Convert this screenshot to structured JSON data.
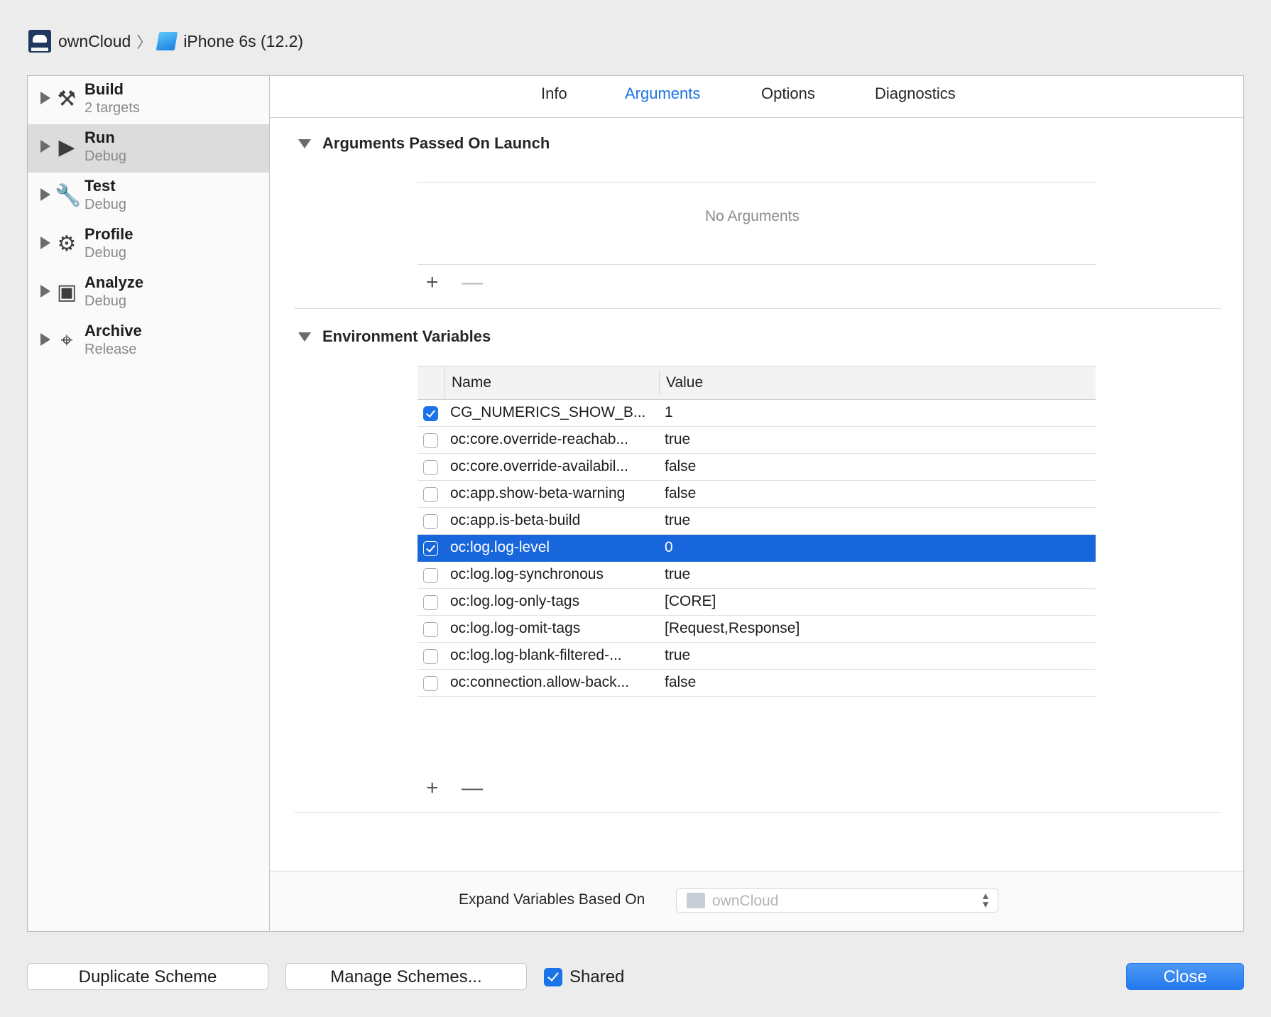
{
  "breadcrumb": {
    "project": "ownCloud",
    "separator": "〉",
    "device": "iPhone 6s (12.2)"
  },
  "sidebar": {
    "items": [
      {
        "title": "Build",
        "subtitle": "2 targets",
        "icon": "hammer-icon",
        "glyph": "⚒"
      },
      {
        "title": "Run",
        "subtitle": "Debug",
        "icon": "play-icon",
        "glyph": "▶"
      },
      {
        "title": "Test",
        "subtitle": "Debug",
        "icon": "wrench-icon",
        "glyph": "🔧"
      },
      {
        "title": "Profile",
        "subtitle": "Debug",
        "icon": "instruments-icon",
        "glyph": "⚙"
      },
      {
        "title": "Analyze",
        "subtitle": "Debug",
        "icon": "analyze-icon",
        "glyph": "▣"
      },
      {
        "title": "Archive",
        "subtitle": "Release",
        "icon": "archive-icon",
        "glyph": "⌖"
      }
    ],
    "selected_index": 1
  },
  "tabs": [
    {
      "label": "Info"
    },
    {
      "label": "Arguments",
      "active": true
    },
    {
      "label": "Options"
    },
    {
      "label": "Diagnostics"
    }
  ],
  "arguments": {
    "heading": "Arguments Passed On Launch",
    "empty_text": "No Arguments",
    "add": "+",
    "remove": "—"
  },
  "environment": {
    "heading": "Environment Variables",
    "columns": {
      "name": "Name",
      "value": "Value"
    },
    "rows": [
      {
        "checked": true,
        "name": "CG_NUMERICS_SHOW_B...",
        "value": "1"
      },
      {
        "checked": false,
        "name": "oc:core.override-reachab...",
        "value": "true"
      },
      {
        "checked": false,
        "name": "oc:core.override-availabil...",
        "value": "false"
      },
      {
        "checked": false,
        "name": "oc:app.show-beta-warning",
        "value": "false"
      },
      {
        "checked": false,
        "name": "oc:app.is-beta-build",
        "value": "true"
      },
      {
        "checked": true,
        "name": "oc:log.log-level",
        "value": "0",
        "selected": true
      },
      {
        "checked": false,
        "name": "oc:log.log-synchronous",
        "value": "true"
      },
      {
        "checked": false,
        "name": "oc:log.log-only-tags",
        "value": "[CORE]"
      },
      {
        "checked": false,
        "name": "oc:log.log-omit-tags",
        "value": "[Request,Response]"
      },
      {
        "checked": false,
        "name": "oc:log.log-blank-filtered-...",
        "value": "true"
      },
      {
        "checked": false,
        "name": "oc:connection.allow-back...",
        "value": "false"
      }
    ],
    "add": "+",
    "remove": "—"
  },
  "expand": {
    "label": "Expand Variables Based On",
    "value": "ownCloud"
  },
  "buttons": {
    "duplicate": "Duplicate Scheme",
    "manage": "Manage Schemes...",
    "shared": "Shared",
    "close": "Close"
  },
  "colors": {
    "accent": "#1a73e8",
    "selection": "#1866dc"
  }
}
